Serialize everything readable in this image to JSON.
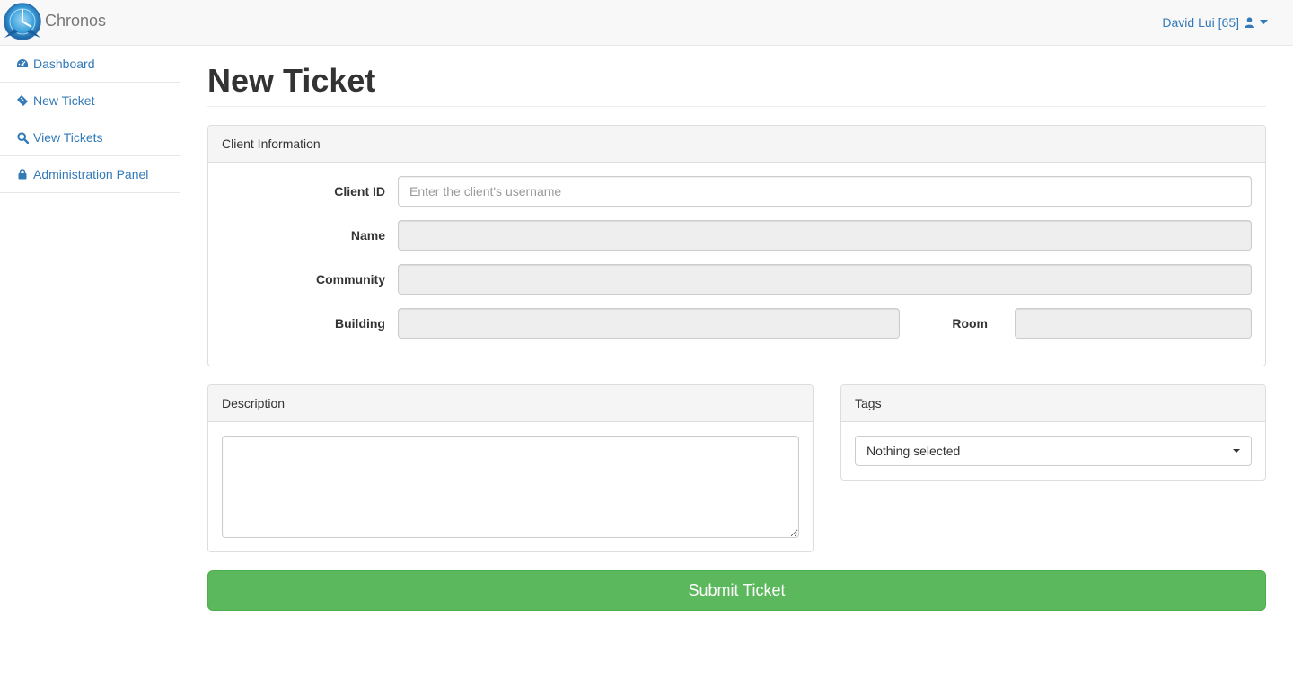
{
  "app": {
    "brand": "Chronos",
    "user_label": "David Lui [65]"
  },
  "sidebar": {
    "items": [
      {
        "label": "Dashboard",
        "icon": "dashboard-icon"
      },
      {
        "label": "New Ticket",
        "icon": "ticket-icon"
      },
      {
        "label": "View Tickets",
        "icon": "search-icon"
      },
      {
        "label": "Administration Panel",
        "icon": "lock-icon"
      }
    ]
  },
  "main": {
    "title": "New Ticket",
    "client_panel": {
      "heading": "Client Information",
      "client_id_label": "Client ID",
      "client_id_placeholder": "Enter the client's username",
      "client_id_value": "",
      "name_label": "Name",
      "community_label": "Community",
      "building_label": "Building",
      "room_label": "Room"
    },
    "description_panel": {
      "heading": "Description",
      "value": ""
    },
    "tags_panel": {
      "heading": "Tags",
      "selected": "Nothing selected"
    },
    "submit_label": "Submit Ticket"
  },
  "colors": {
    "link": "#337ab7",
    "success": "#5cb85c",
    "panel_heading_bg": "#f5f5f5"
  }
}
